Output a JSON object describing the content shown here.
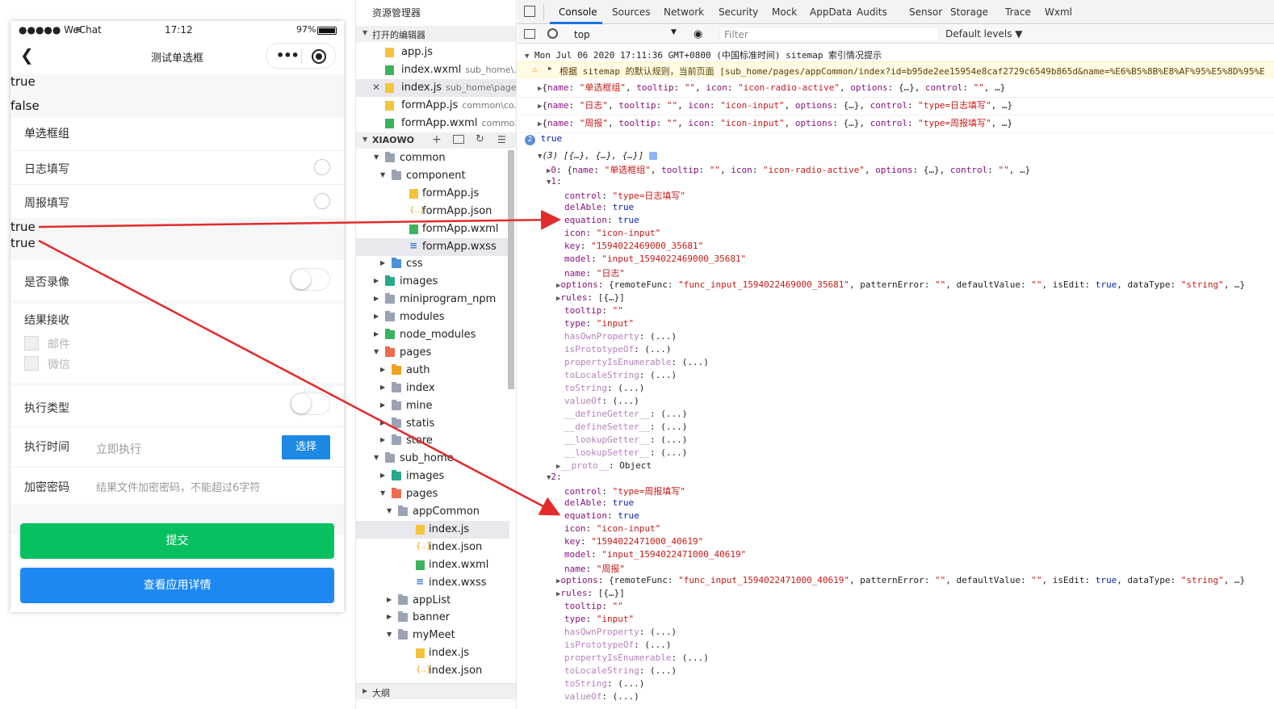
{
  "phone": {
    "carrier": "●●●●● WeChat",
    "time": "17:12",
    "battery": "97%",
    "title": "测试单选框",
    "lines": [
      "true",
      "false",
      "true",
      "true"
    ],
    "radio_group": "单选框组",
    "radio_options": [
      "日志填写",
      "周报填写"
    ],
    "record_label": "是否录像",
    "result_label": "结果接收",
    "checkbox_options": [
      "邮件",
      "微信"
    ],
    "exec_type_label": "执行类型",
    "exec_time_label": "执行时间",
    "exec_time_value": "立即执行",
    "select_button": "选择",
    "password_label": "加密密码",
    "password_placeholder": "结果文件加密密码，不能超过6字符",
    "submit_button": "提交",
    "details_button": "查看应用详情",
    "colors": {
      "submit": "#07c160",
      "details": "#1e88f2"
    }
  },
  "explorer": {
    "title": "资源管理器",
    "open_editors_label": "打开的编辑器",
    "open_editors": [
      {
        "name": "app.js",
        "path": ""
      },
      {
        "name": "index.wxml",
        "path": "sub_home\\..."
      },
      {
        "name": "index.js",
        "path": "sub_home\\page..."
      },
      {
        "name": "formApp.js",
        "path": "common\\co..."
      },
      {
        "name": "formApp.wxml",
        "path": "commo..."
      }
    ],
    "project_label": "XIAOWO",
    "outline_label": "大纲",
    "tree": [
      "common",
      "component",
      "formApp.js",
      "formApp.json",
      "formApp.wxml",
      "formApp.wxss",
      "css",
      "images",
      "miniprogram_npm",
      "modules",
      "node_modules",
      "pages",
      "auth",
      "index",
      "mine",
      "statis",
      "store",
      "sub_home",
      "images",
      "pages",
      "appCommon",
      "index.js",
      "index.json",
      "index.wxml",
      "index.wxss",
      "appList",
      "banner",
      "myMeet",
      "index.js",
      "index.json"
    ]
  },
  "devtools": {
    "tabs": [
      "Console",
      "Sources",
      "Network",
      "Security",
      "Mock",
      "AppData",
      "Audits",
      "Sensor",
      "Storage",
      "Trace",
      "Wxml"
    ],
    "context": "top",
    "filter_placeholder": "Filter",
    "levels": "Default levels ▼",
    "log_time": "Mon Jul 06 2020 17:11:36 GMT+0800 (中国标准时间) sitemap 索引情况提示",
    "warn_text": "根据 sitemap 的默认规则，当前页面 [sub_home/pages/appCommon/index?id=b95de2ee15954e8caf2729c6549b865d&name=%E6%B5%8B%E8%AF%95%E5%8D%95%E",
    "obj1_name": "单选框组",
    "obj1_icon": "icon-radio-active",
    "obj2_name": "日志",
    "obj2_control": "type=日志填写",
    "obj3_name": "周报",
    "obj3_control": "type=周报填写",
    "true_count": "2",
    "true_text": "true",
    "array_head": "(3) [{…}, {…}, {…}]",
    "items": [
      {
        "control": "type=日志填写",
        "key": "1594022469000_35681",
        "model": "input_1594022469000_35681",
        "name": "日志",
        "func": "func_input_1594022469000_35681"
      },
      {
        "control": "type=周报填写",
        "key": "1594022471000_40619",
        "model": "input_1594022471000_40619",
        "name": "周报",
        "func": "func_input_1594022471000_40619"
      }
    ]
  }
}
